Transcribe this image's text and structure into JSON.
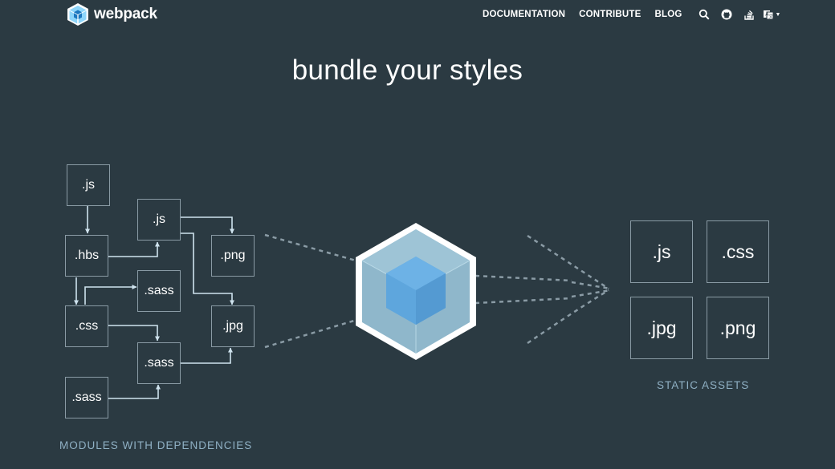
{
  "header": {
    "brand": "webpack",
    "nav": [
      {
        "label": "DOCUMENTATION"
      },
      {
        "label": "CONTRIBUTE"
      },
      {
        "label": "BLOG"
      }
    ],
    "icons": [
      "search-icon",
      "github-icon",
      "stack-overflow-icon",
      "language-icon"
    ]
  },
  "hero": {
    "title": "bundle your styles"
  },
  "modules": {
    "caption": "MODULES WITH DEPENDENCIES",
    "items": [
      {
        "label": ".js"
      },
      {
        "label": ".js"
      },
      {
        "label": ".hbs"
      },
      {
        "label": ".png"
      },
      {
        "label": ".sass"
      },
      {
        "label": ".css"
      },
      {
        "label": ".jpg"
      },
      {
        "label": ".sass"
      },
      {
        "label": ".sass"
      }
    ]
  },
  "assets": {
    "caption": "STATIC ASSETS",
    "items": [
      {
        "label": ".js"
      },
      {
        "label": ".css"
      },
      {
        "label": ".jpg"
      },
      {
        "label": ".png"
      }
    ]
  },
  "colors": {
    "background": "#2b3a42",
    "box_border": "#8a9ba5",
    "arrow": "#cfe3ee",
    "caption": "#8fb0c4",
    "cube_outer": "#8ed6fb",
    "cube_inner": "#1c78c0"
  }
}
